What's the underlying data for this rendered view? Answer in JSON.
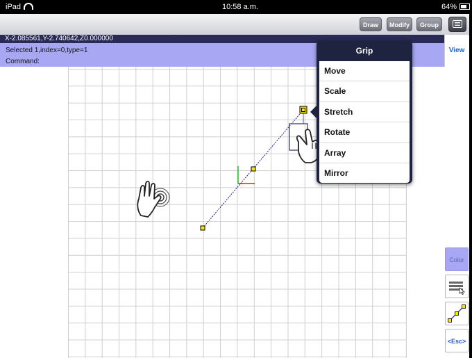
{
  "status_bar": {
    "device": "iPad",
    "time": "10:58 a.m.",
    "battery": "64%"
  },
  "toolbar": {
    "draw_label": "Draw",
    "modify_label": "Modify",
    "group_label": "Group",
    "menu_icon": "menu-icon"
  },
  "info": {
    "coordinates": "X-2.085561,Y-2.740642,Z0.000000",
    "selection": "Selected 1,index=0,type=1",
    "command": "Command:"
  },
  "view_tab": {
    "label": "View"
  },
  "grip_menu": {
    "title": "Grip",
    "items": [
      "Move",
      "Scale",
      "Stretch",
      "Rotate",
      "Array",
      "Mirror"
    ]
  },
  "right_panel": {
    "color_label": "Color",
    "esc_label": "<Esc>",
    "layers_icon": "layers-icon",
    "line-icon": "line-tool-icon"
  },
  "colors": {
    "info_panel": "#a7a7f4",
    "coord_bar": "#2a2b55",
    "popover": "#1e2340",
    "line": "#1a1a8a",
    "grip": "#f2e600"
  }
}
